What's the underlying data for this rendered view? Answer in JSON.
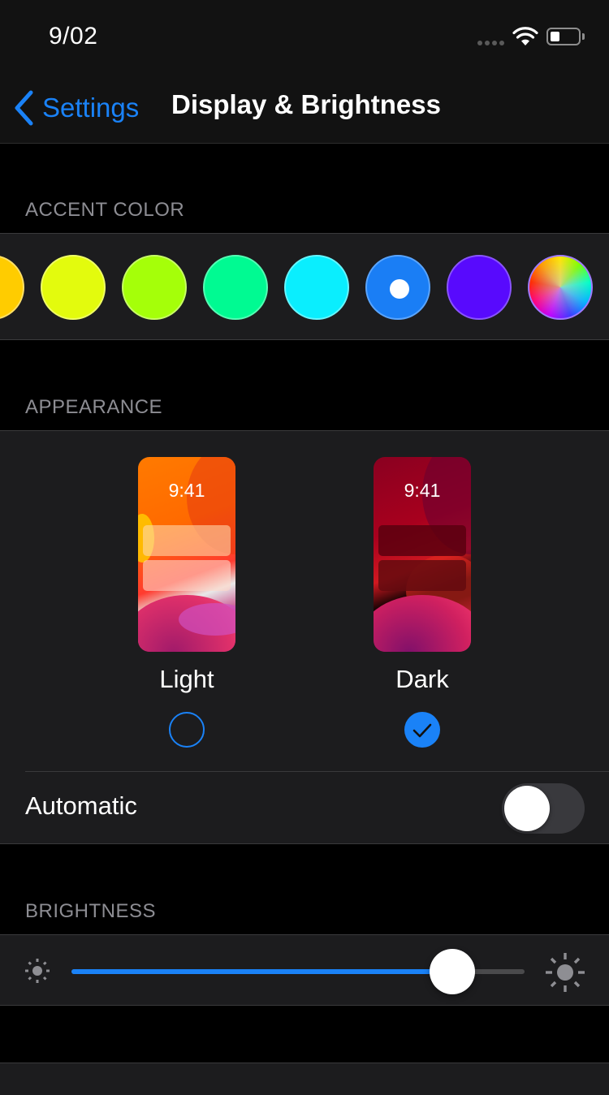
{
  "status_bar": {
    "time": "9/02",
    "battery_level": 0.35,
    "wifi": "wifi-icon",
    "signal": "signal-dots-icon"
  },
  "nav": {
    "back_label": "Settings",
    "title": "Display & Brightness"
  },
  "accent_color": {
    "header": "ACCENT COLOR",
    "colors": [
      {
        "name": "yellow-orange",
        "hex": "#ffcc00",
        "border": "#ffe066"
      },
      {
        "name": "yellow",
        "hex": "#e3fb0d",
        "border": "#f0ff66"
      },
      {
        "name": "lime",
        "hex": "#a5ff09",
        "border": "#c8ff66"
      },
      {
        "name": "green",
        "hex": "#00fa92",
        "border": "#55ffb5"
      },
      {
        "name": "cyan",
        "hex": "#0aeefe",
        "border": "#66f6ff"
      },
      {
        "name": "blue",
        "hex": "#1a7ef5",
        "border": "#5aa5ff"
      },
      {
        "name": "purple",
        "hex": "#580afd",
        "border": "#8a55ff"
      },
      {
        "name": "multicolor",
        "hex": "rainbow",
        "border": "#a07aff"
      }
    ],
    "selected": "blue"
  },
  "appearance": {
    "header": "APPEARANCE",
    "options": [
      {
        "label": "Light",
        "preview_time": "9:41",
        "selected": false
      },
      {
        "label": "Dark",
        "preview_time": "9:41",
        "selected": true
      }
    ],
    "automatic_label": "Automatic",
    "automatic_on": false
  },
  "brightness": {
    "header": "BRIGHTNESS",
    "value_percent": 84,
    "min_icon": "sun-small-icon",
    "max_icon": "sun-large-icon"
  },
  "colors": {
    "accent": "#1a82f7",
    "panel": "#1c1c1e",
    "background": "#000000"
  }
}
